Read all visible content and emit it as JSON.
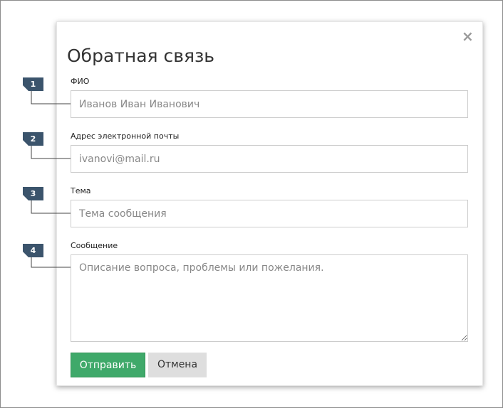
{
  "dialog": {
    "title": "Обратная связь",
    "close_glyph": "×"
  },
  "form": {
    "fio": {
      "label": "ФИО",
      "value": "",
      "placeholder": "Иванов Иван Иванович"
    },
    "email": {
      "label": "Адрес электронной почты",
      "value": "",
      "placeholder": "ivanovi@mail.ru"
    },
    "subject": {
      "label": "Тема",
      "value": "",
      "placeholder": "Тема сообщения"
    },
    "message": {
      "label": "Сообщение",
      "value": "",
      "placeholder": "Описание вопроса, проблемы или пожелания."
    }
  },
  "buttons": {
    "submit_label": "Отправить",
    "cancel_label": "Отмена"
  },
  "callouts": [
    "1",
    "2",
    "3",
    "4"
  ],
  "colors": {
    "submit_bg": "#3fa96a",
    "cancel_bg": "#dedede",
    "callout_bg": "#3b546c"
  }
}
